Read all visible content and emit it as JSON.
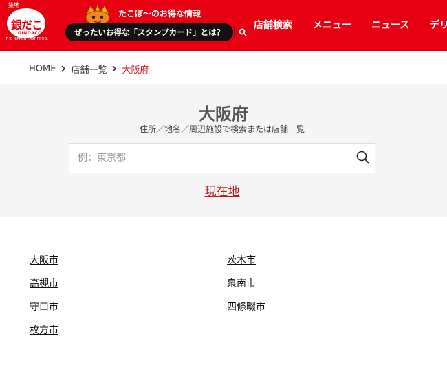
{
  "header": {
    "logo": {
      "kanji": "築地",
      "main": "銀だこ",
      "romaji": "GINDACO",
      "tagline": "THE NIPPON FAST FOOD."
    },
    "promo_heading": "たこぼ〜のお得な情報",
    "promo_button": "ぜったいお得な「スタンプカード」とは？",
    "nav": [
      "店舗検索",
      "メニュー",
      "ニュース",
      "デリ"
    ],
    "brand_color": "#e60012"
  },
  "breadcrumb": {
    "home": "HOME",
    "list": "店舗一覧",
    "current": "大阪府"
  },
  "search": {
    "title": "大阪府",
    "subtitle": "住所／地名／周辺施設で検索または店舗一覧",
    "placeholder": "例：東京都",
    "value": "",
    "current_location": "現在地"
  },
  "cities": {
    "left": [
      {
        "name": "大阪市",
        "link": true
      },
      {
        "name": "高槻市",
        "link": true
      },
      {
        "name": "守口市",
        "link": true
      },
      {
        "name": "枚方市",
        "link": true
      }
    ],
    "right": [
      {
        "name": "茨木市",
        "link": true
      },
      {
        "name": "泉南市",
        "link": false
      },
      {
        "name": "四條畷市",
        "link": true
      }
    ]
  },
  "colors": {
    "accent_red": "#c8161d",
    "panel_bg": "#f5f5f5"
  }
}
